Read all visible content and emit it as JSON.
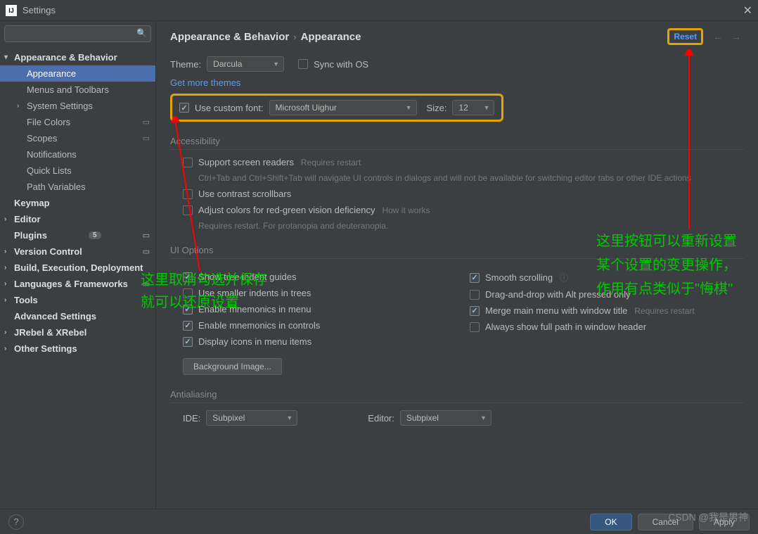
{
  "window": {
    "title": "Settings"
  },
  "search": {
    "placeholder": ""
  },
  "sidebar": {
    "items": [
      {
        "label": "Appearance & Behavior",
        "bold": true,
        "chev": "▾"
      },
      {
        "label": "Appearance",
        "selected": true,
        "level": 2
      },
      {
        "label": "Menus and Toolbars",
        "level": 2
      },
      {
        "label": "System Settings",
        "level": 2,
        "chev": "›"
      },
      {
        "label": "File Colors",
        "level": 2,
        "badge": "▭"
      },
      {
        "label": "Scopes",
        "level": 2,
        "badge": "▭"
      },
      {
        "label": "Notifications",
        "level": 2
      },
      {
        "label": "Quick Lists",
        "level": 2
      },
      {
        "label": "Path Variables",
        "level": 2
      },
      {
        "label": "Keymap",
        "bold": true
      },
      {
        "label": "Editor",
        "bold": true,
        "chev": "›"
      },
      {
        "label": "Plugins",
        "bold": true,
        "count": "5",
        "badge": "▭"
      },
      {
        "label": "Version Control",
        "bold": true,
        "chev": "›",
        "badge": "▭"
      },
      {
        "label": "Build, Execution, Deployment",
        "bold": true,
        "chev": "›"
      },
      {
        "label": "Languages & Frameworks",
        "bold": true,
        "chev": "›",
        "badge": "▭"
      },
      {
        "label": "Tools",
        "bold": true,
        "chev": "›"
      },
      {
        "label": "Advanced Settings",
        "bold": true
      },
      {
        "label": "JRebel & XRebel",
        "bold": true,
        "chev": "›"
      },
      {
        "label": "Other Settings",
        "bold": true,
        "chev": "›"
      }
    ]
  },
  "breadcrumb": {
    "a": "Appearance & Behavior",
    "b": "Appearance",
    "reset": "Reset"
  },
  "theme": {
    "label": "Theme:",
    "value": "Darcula",
    "sync": "Sync with OS",
    "more": "Get more themes"
  },
  "font": {
    "use": "Use custom font:",
    "value": "Microsoft Uighur",
    "size_label": "Size:",
    "size": "12"
  },
  "acc": {
    "title": "Accessibility",
    "sr": "Support screen readers",
    "sr_hint": "Requires restart",
    "sr_sub": "Ctrl+Tab and Ctrl+Shift+Tab will navigate UI controls in dialogs and will not be available for switching editor tabs or other IDE actions",
    "contrast": "Use contrast scrollbars",
    "rg": "Adjust colors for red-green vision deficiency",
    "rg_link": "How it works",
    "rg_sub": "Requires restart. For protanopia and deuteranopia."
  },
  "ui": {
    "title": "UI Options",
    "tree_guides": "Show tree indent guides",
    "smaller": "Use smaller indents in trees",
    "mnem_menu": "Enable mnemonics in menu",
    "mnem_ctrl": "Enable mnemonics in controls",
    "icons": "Display icons in menu items",
    "smooth": "Smooth scrolling",
    "dnd": "Drag-and-drop with Alt pressed only",
    "merge": "Merge main menu with window title",
    "merge_hint": "Requires restart",
    "fullpath": "Always show full path in window header",
    "bgimg": "Background Image..."
  },
  "aa": {
    "title": "Antialiasing",
    "ide_label": "IDE:",
    "ide": "Subpixel",
    "ed_label": "Editor:",
    "ed": "Subpixel"
  },
  "footer": {
    "ok": "OK",
    "cancel": "Cancel",
    "apply": "Apply"
  },
  "annot": {
    "left": "这里取消勾选并保存\n就可以还原设置",
    "right": "这里按钮可以重新设置某个设置的变更操作，作用有点类似于\"悔棋\"",
    "watermark": "CSDN @我是男神"
  }
}
